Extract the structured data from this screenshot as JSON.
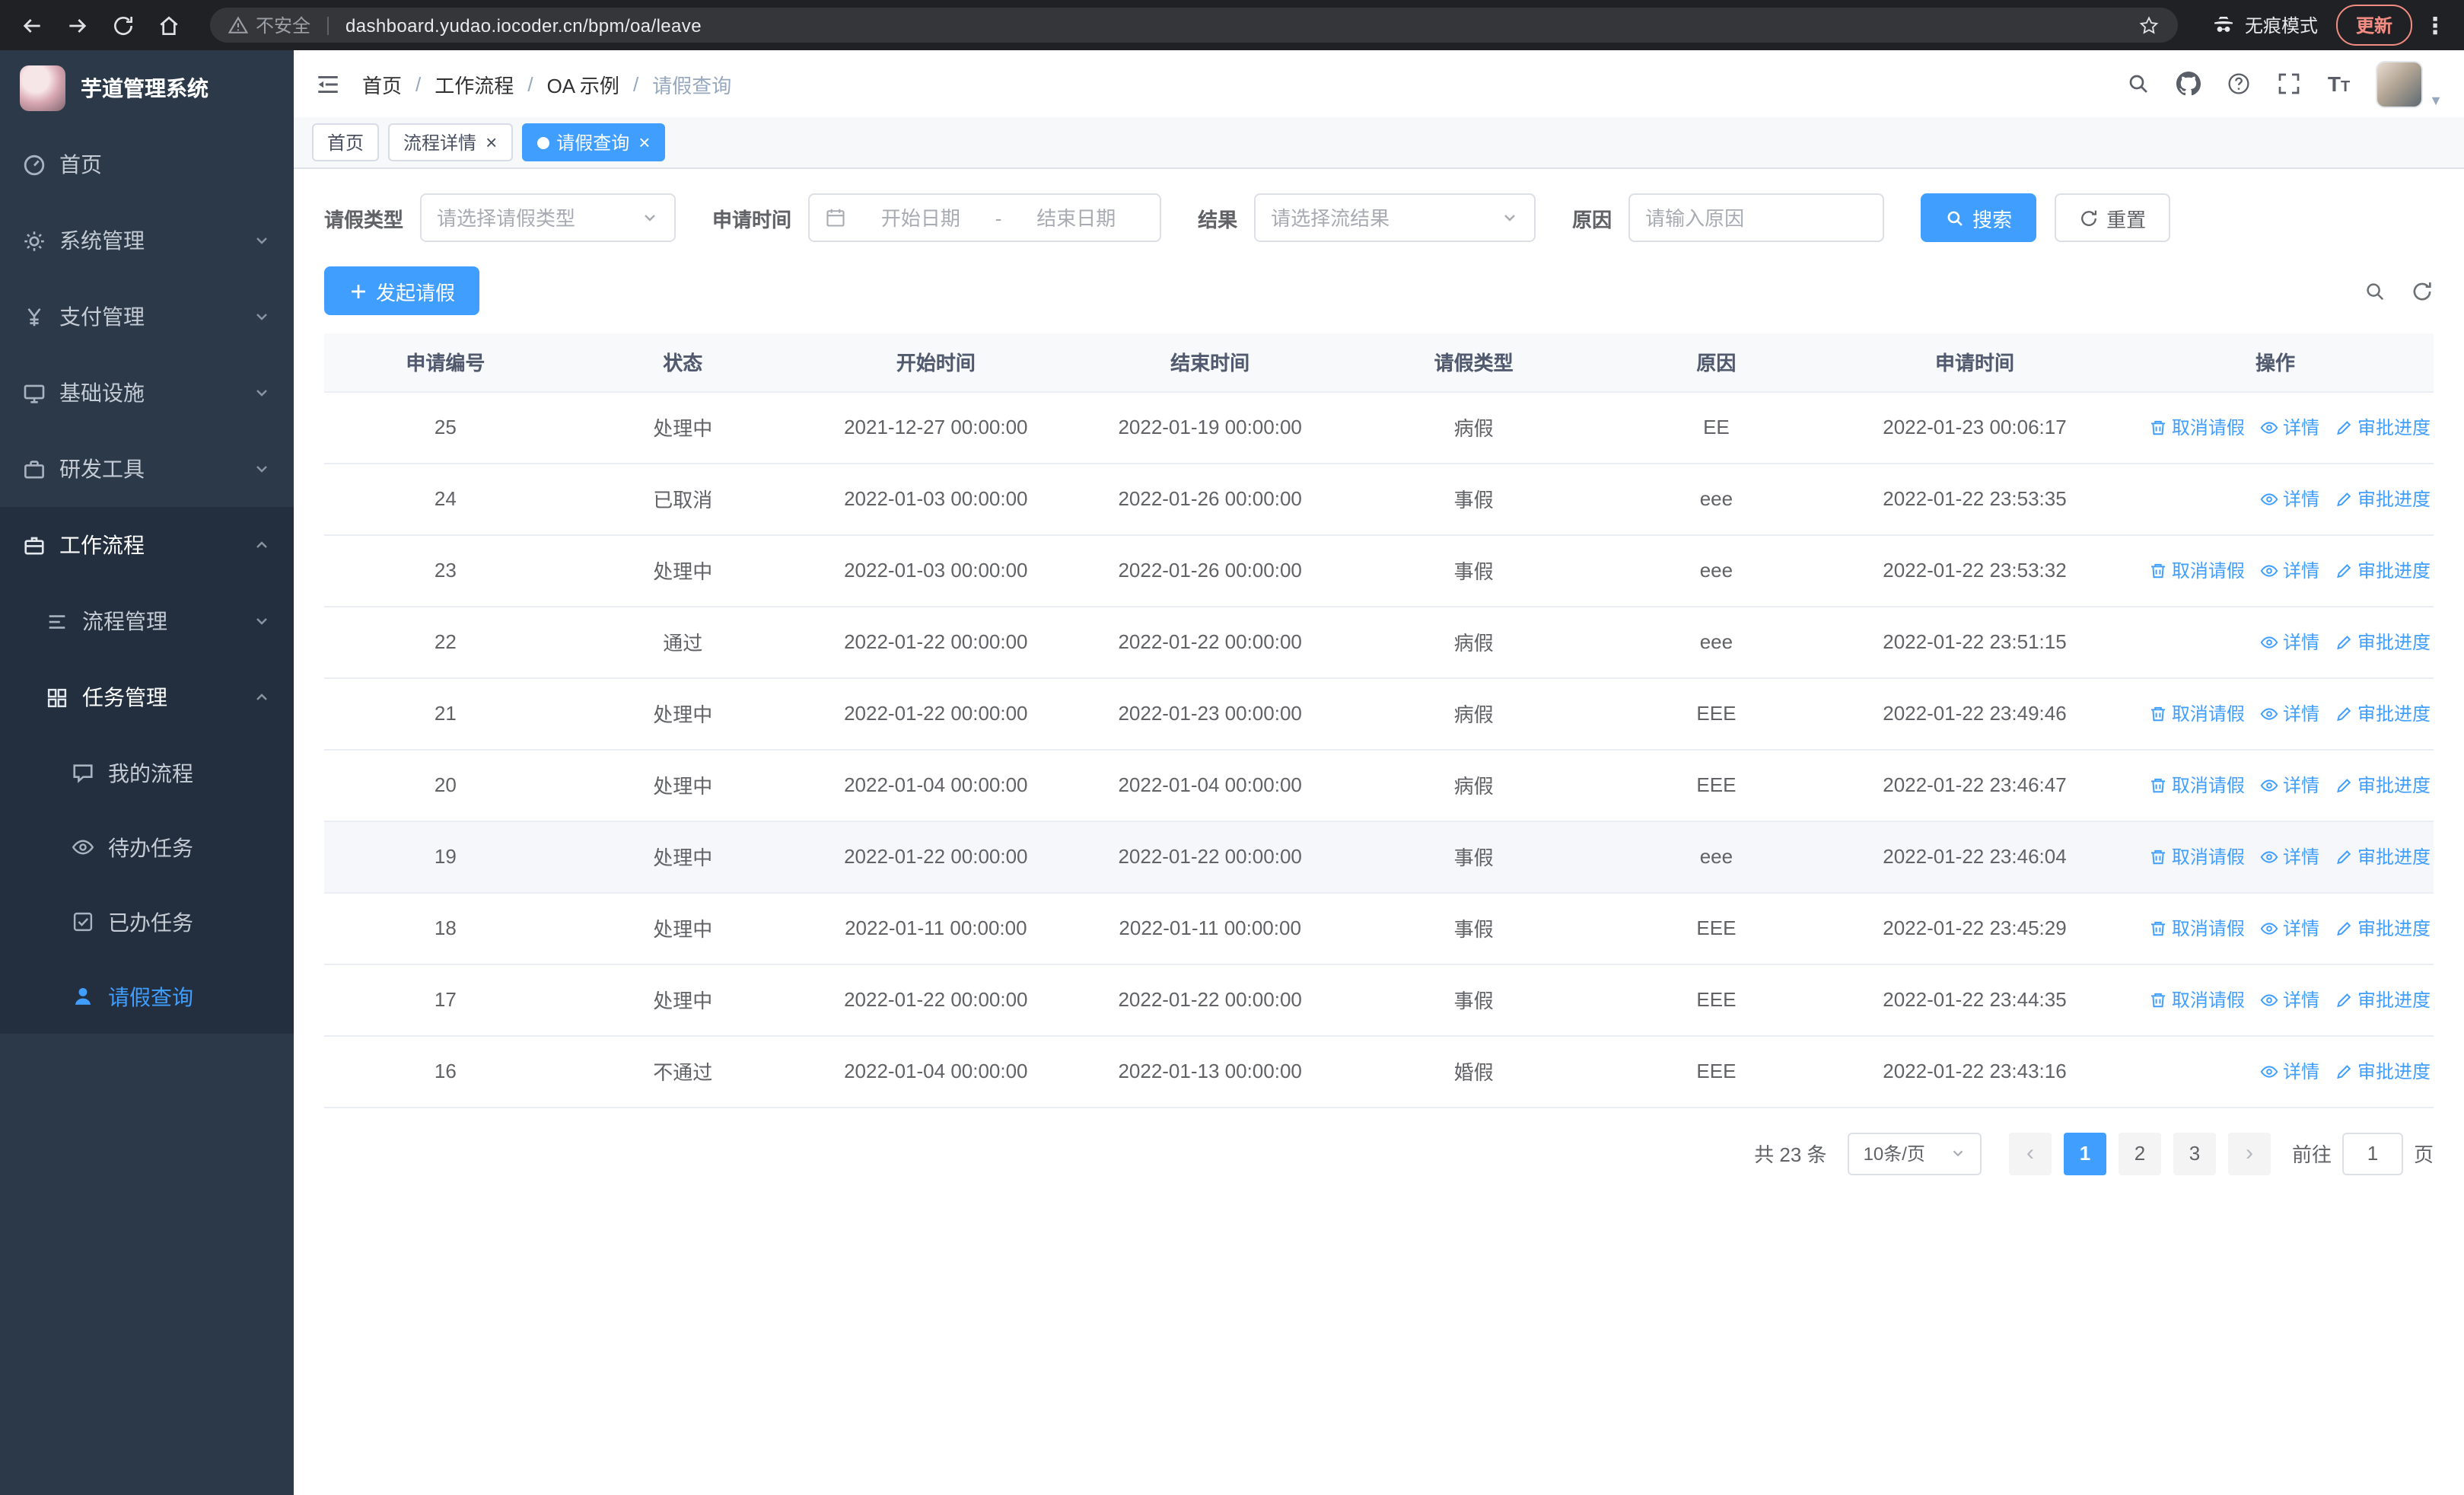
{
  "browser": {
    "security_label": "不安全",
    "url": "dashboard.yudao.iocoder.cn/bpm/oa/leave",
    "incognito_label": "无痕模式",
    "update_label": "更新"
  },
  "sidebar": {
    "app_title": "芋道管理系统",
    "items": [
      {
        "label": "首页",
        "level": 1
      },
      {
        "label": "系统管理",
        "level": 1,
        "chevron": "down"
      },
      {
        "label": "支付管理",
        "level": 1,
        "chevron": "down"
      },
      {
        "label": "基础设施",
        "level": 1,
        "chevron": "down"
      },
      {
        "label": "研发工具",
        "level": 1,
        "chevron": "down"
      },
      {
        "label": "工作流程",
        "level": 1,
        "chevron": "up",
        "expanded": true
      },
      {
        "label": "流程管理",
        "level": 2,
        "chevron": "down"
      },
      {
        "label": "任务管理",
        "level": 2,
        "chevron": "up",
        "expanded": true
      },
      {
        "label": "我的流程",
        "level": 3
      },
      {
        "label": "待办任务",
        "level": 3
      },
      {
        "label": "已办任务",
        "level": 3
      },
      {
        "label": "请假查询",
        "level": 3,
        "active": true
      }
    ]
  },
  "header": {
    "breadcrumb": [
      "首页",
      "工作流程",
      "OA 示例",
      "请假查询"
    ],
    "breadcrumb_separator": "/",
    "icons": [
      "search-icon",
      "github-icon",
      "help-icon",
      "fullscreen-icon",
      "font-size-icon",
      "avatar"
    ]
  },
  "tabs": [
    {
      "label": "首页",
      "closable": false,
      "active": false
    },
    {
      "label": "流程详情",
      "closable": true,
      "active": false
    },
    {
      "label": "请假查询",
      "closable": true,
      "active": true
    }
  ],
  "filters": {
    "leave_type_label": "请假类型",
    "leave_type_placeholder": "请选择请假类型",
    "apply_time_label": "申请时间",
    "start_date_placeholder": "开始日期",
    "range_separator": "-",
    "end_date_placeholder": "结束日期",
    "result_label": "结果",
    "result_placeholder": "请选择流结果",
    "reason_label": "原因",
    "reason_placeholder": "请输入原因",
    "search_label": "搜索",
    "reset_label": "重置"
  },
  "toolbar": {
    "create_label": "发起请假"
  },
  "table": {
    "columns": [
      "申请编号",
      "状态",
      "开始时间",
      "结束时间",
      "请假类型",
      "原因",
      "申请时间",
      "操作"
    ],
    "column_keys": [
      "id",
      "status",
      "start",
      "end",
      "type",
      "reason",
      "applied"
    ],
    "action_labels": {
      "cancel": "取消请假",
      "detail": "详情",
      "progress": "审批进度"
    },
    "rows": [
      {
        "id": "25",
        "status": "处理中",
        "start": "2021-12-27 00:00:00",
        "end": "2022-01-19 00:00:00",
        "type": "病假",
        "reason": "EE",
        "applied": "2022-01-23 00:06:17",
        "actions": [
          "cancel",
          "detail",
          "progress"
        ]
      },
      {
        "id": "24",
        "status": "已取消",
        "start": "2022-01-03 00:00:00",
        "end": "2022-01-26 00:00:00",
        "type": "事假",
        "reason": "eee",
        "applied": "2022-01-22 23:53:35",
        "actions": [
          "detail",
          "progress"
        ]
      },
      {
        "id": "23",
        "status": "处理中",
        "start": "2022-01-03 00:00:00",
        "end": "2022-01-26 00:00:00",
        "type": "事假",
        "reason": "eee",
        "applied": "2022-01-22 23:53:32",
        "actions": [
          "cancel",
          "detail",
          "progress"
        ]
      },
      {
        "id": "22",
        "status": "通过",
        "start": "2022-01-22 00:00:00",
        "end": "2022-01-22 00:00:00",
        "type": "病假",
        "reason": "eee",
        "applied": "2022-01-22 23:51:15",
        "actions": [
          "detail",
          "progress"
        ]
      },
      {
        "id": "21",
        "status": "处理中",
        "start": "2022-01-22 00:00:00",
        "end": "2022-01-23 00:00:00",
        "type": "病假",
        "reason": "EEE",
        "applied": "2022-01-22 23:49:46",
        "actions": [
          "cancel",
          "detail",
          "progress"
        ]
      },
      {
        "id": "20",
        "status": "处理中",
        "start": "2022-01-04 00:00:00",
        "end": "2022-01-04 00:00:00",
        "type": "病假",
        "reason": "EEE",
        "applied": "2022-01-22 23:46:47",
        "actions": [
          "cancel",
          "detail",
          "progress"
        ]
      },
      {
        "id": "19",
        "status": "处理中",
        "start": "2022-01-22 00:00:00",
        "end": "2022-01-22 00:00:00",
        "type": "事假",
        "reason": "eee",
        "applied": "2022-01-22 23:46:04",
        "actions": [
          "cancel",
          "detail",
          "progress"
        ],
        "hovered": true
      },
      {
        "id": "18",
        "status": "处理中",
        "start": "2022-01-11 00:00:00",
        "end": "2022-01-11 00:00:00",
        "type": "事假",
        "reason": "EEE",
        "applied": "2022-01-22 23:45:29",
        "actions": [
          "cancel",
          "detail",
          "progress"
        ]
      },
      {
        "id": "17",
        "status": "处理中",
        "start": "2022-01-22 00:00:00",
        "end": "2022-01-22 00:00:00",
        "type": "事假",
        "reason": "EEE",
        "applied": "2022-01-22 23:44:35",
        "actions": [
          "cancel",
          "detail",
          "progress"
        ]
      },
      {
        "id": "16",
        "status": "不通过",
        "start": "2022-01-04 00:00:00",
        "end": "2022-01-13 00:00:00",
        "type": "婚假",
        "reason": "EEE",
        "applied": "2022-01-22 23:43:16",
        "actions": [
          "detail",
          "progress"
        ]
      }
    ]
  },
  "pagination": {
    "total_label": "共 23 条",
    "page_size_label": "10条/页",
    "pages": [
      "1",
      "2",
      "3"
    ],
    "active_page": "1",
    "goto_label": "前往",
    "goto_value": "1",
    "goto_suffix": "页"
  },
  "colors": {
    "primary": "#409eff",
    "sidebar_bg": "#2b3949",
    "sidebar_submenu_bg": "#232f3e",
    "sidebar_active_text": "#409eff",
    "update_badge": "#f28b82",
    "browser_bar_bg": "#202124"
  }
}
